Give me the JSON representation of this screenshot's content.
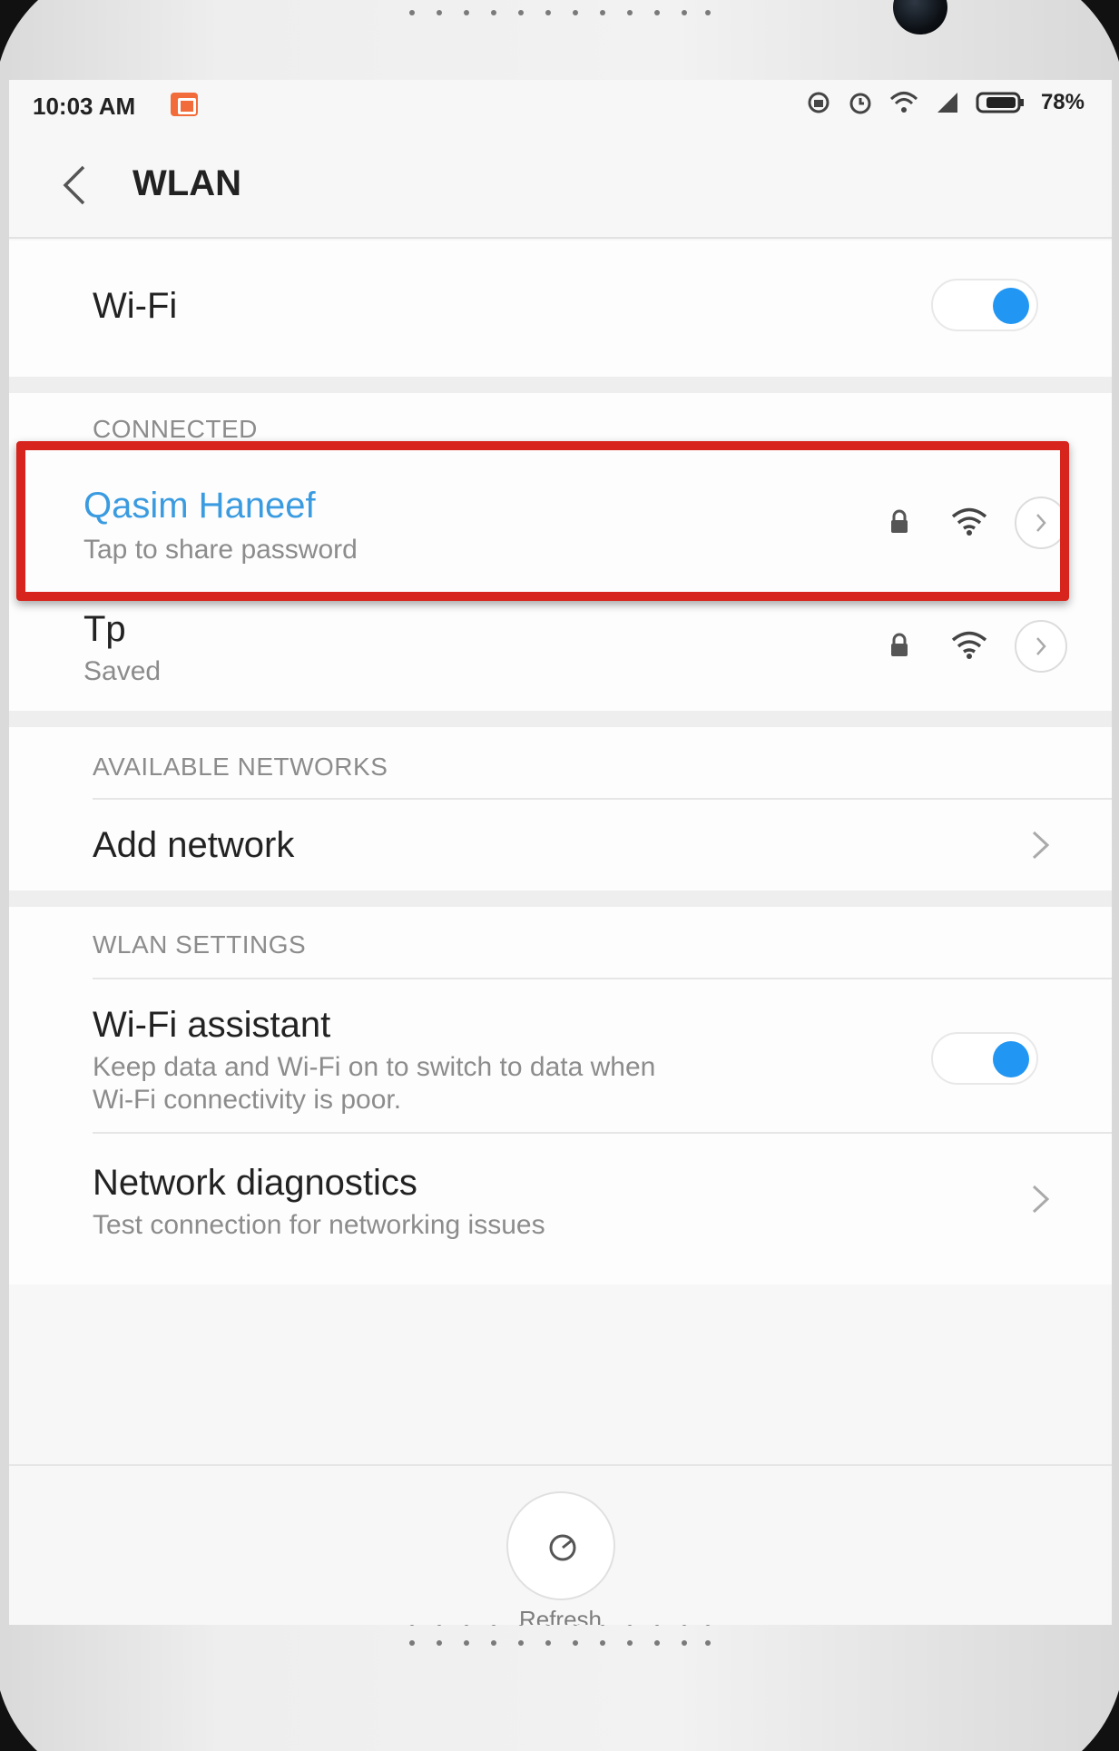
{
  "status_bar": {
    "time": "10:03 AM",
    "battery": "78%"
  },
  "header": {
    "title": "WLAN"
  },
  "wifi": {
    "label": "Wi-Fi",
    "enabled": true
  },
  "connected": {
    "section_label": "CONNECTED",
    "networks": [
      {
        "name": "Qasim Haneef",
        "status": "Tap to share password",
        "secured": true,
        "color": "#3a9be0"
      },
      {
        "name": "Tp",
        "status": "Saved",
        "secured": true
      }
    ]
  },
  "available": {
    "section_label": "AVAILABLE NETWORKS",
    "add_network_label": "Add network"
  },
  "wlan_settings": {
    "section_label": "WLAN SETTINGS",
    "assistant_title": "Wi-Fi assistant",
    "assistant_desc_line1": "Keep data and Wi-Fi on to switch to data when",
    "assistant_desc_line2": "Wi-Fi connectivity is poor.",
    "assistant_enabled": true,
    "diagnostics_title": "Network diagnostics",
    "diagnostics_desc": "Test connection for networking issues"
  },
  "footer": {
    "refresh_label": "Refresh"
  },
  "colors": {
    "toggle_on": "#2196f3",
    "connected_name": "#3a9be0",
    "highlight_box": "#d7241c"
  }
}
